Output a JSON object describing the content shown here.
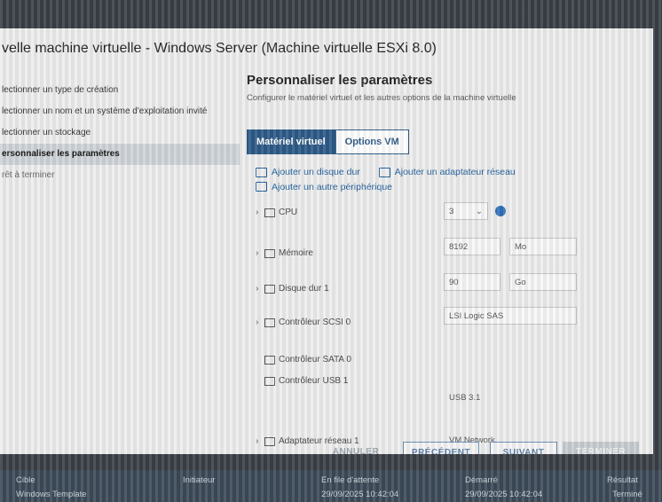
{
  "dialog": {
    "title": "velle machine virtuelle - Windows Server (Machine virtuelle ESXi 8.0)"
  },
  "steps": [
    {
      "label": "lectionner un type de création"
    },
    {
      "label": "lectionner un nom et un système d'exploitation invité"
    },
    {
      "label": "lectionner un stockage"
    },
    {
      "label": "ersonnaliser les paramètres"
    },
    {
      "label": "rêt à terminer"
    }
  ],
  "main": {
    "title": "Personnaliser les paramètres",
    "subtitle": "Configurer le matériel virtuel et les autres options de la machine virtuelle"
  },
  "tabs": [
    {
      "label": "Matériel virtuel"
    },
    {
      "label": "Options VM"
    }
  ],
  "actions": {
    "add_disk": "Ajouter un disque dur",
    "add_network": "Ajouter un adaptateur réseau",
    "add_other": "Ajouter un autre périphérique"
  },
  "hardware": {
    "cpu": {
      "label": "CPU",
      "value": "3"
    },
    "memory": {
      "label": "Mémoire",
      "value": "8192",
      "unit": "Mo"
    },
    "disk": {
      "label": "Disque dur 1",
      "value": "90",
      "unit": "Go"
    },
    "scsi": {
      "label": "Contrôleur SCSI 0",
      "value": "LSI Logic SAS"
    },
    "sata": {
      "label": "Contrôleur SATA 0"
    },
    "usb": {
      "label": "Contrôleur USB 1",
      "value": "USB 3.1"
    },
    "network": {
      "label": "Adaptateur réseau 1",
      "value": "VM Network"
    }
  },
  "footer": {
    "cancel": "ANNULER",
    "previous": "PRÉCÉDENT",
    "next": "SUIVANT",
    "finish": "TERMINER"
  },
  "taskbar": {
    "col_target": "Cible",
    "col_initiator": "Initiateur",
    "col_queued": "En file d'attente",
    "col_started": "Démarré",
    "col_result": "Résultat",
    "row_target": "Windows Template",
    "row_queued": "29/09/2025 10:42:04",
    "row_started": "29/09/2025 10:42:04",
    "row_result": "Terminé"
  }
}
